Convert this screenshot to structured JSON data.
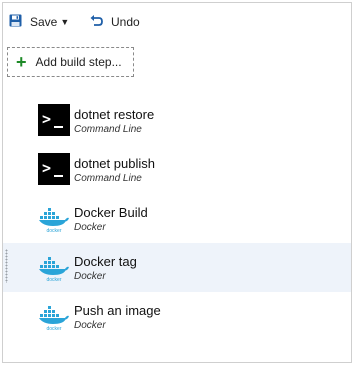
{
  "toolbar": {
    "save_label": "Save",
    "undo_label": "Undo"
  },
  "add_step": {
    "label": "Add build step..."
  },
  "steps": [
    {
      "name": "dotnet restore",
      "type": "Command Line",
      "icon": "command-line-icon"
    },
    {
      "name": "dotnet publish",
      "type": "Command Line",
      "icon": "command-line-icon"
    },
    {
      "name": "Docker Build",
      "type": "Docker",
      "icon": "docker-icon",
      "icon_caption": "docker"
    },
    {
      "name": "Docker tag",
      "type": "Docker",
      "icon": "docker-icon",
      "icon_caption": "docker",
      "selected": true
    },
    {
      "name": "Push an image",
      "type": "Docker",
      "icon": "docker-icon",
      "icon_caption": "docker"
    }
  ],
  "colors": {
    "save_icon": "#1f5fa8",
    "undo_icon": "#1f5fa8",
    "add_plus": "#1e8a28",
    "docker_whale": "#2aa4d8",
    "selected_row": "#eef3fa"
  }
}
